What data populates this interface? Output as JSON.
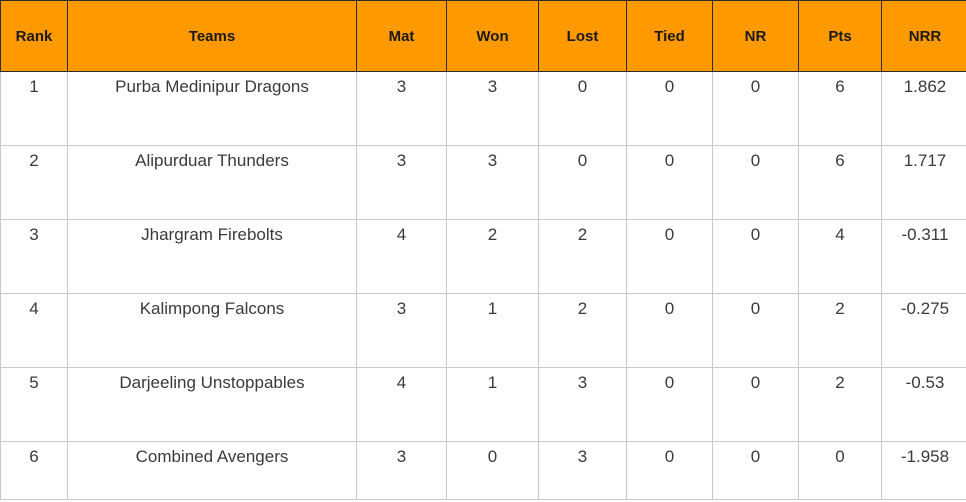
{
  "table": {
    "headers": [
      "Rank",
      "Teams",
      "Mat",
      "Won",
      "Lost",
      "Tied",
      "NR",
      "Pts",
      "NRR"
    ],
    "rows": [
      [
        "1",
        "Purba Medinipur Dragons",
        "3",
        "3",
        "0",
        "0",
        "0",
        "6",
        "1.862"
      ],
      [
        "2",
        "Alipurduar Thunders",
        "3",
        "3",
        "0",
        "0",
        "0",
        "6",
        "1.717"
      ],
      [
        "3",
        "Jhargram Firebolts",
        "4",
        "2",
        "2",
        "0",
        "0",
        "4",
        "-0.311"
      ],
      [
        "4",
        "Kalimpong Falcons",
        "3",
        "1",
        "2",
        "0",
        "0",
        "2",
        "-0.275"
      ],
      [
        "5",
        "Darjeeling Unstoppables",
        "4",
        "1",
        "3",
        "0",
        "0",
        "2",
        "-0.53"
      ],
      [
        "6",
        "Combined Avengers",
        "3",
        "0",
        "3",
        "0",
        "0",
        "0",
        "-1.958"
      ]
    ]
  },
  "colors": {
    "header_bg": "#ff9900"
  }
}
